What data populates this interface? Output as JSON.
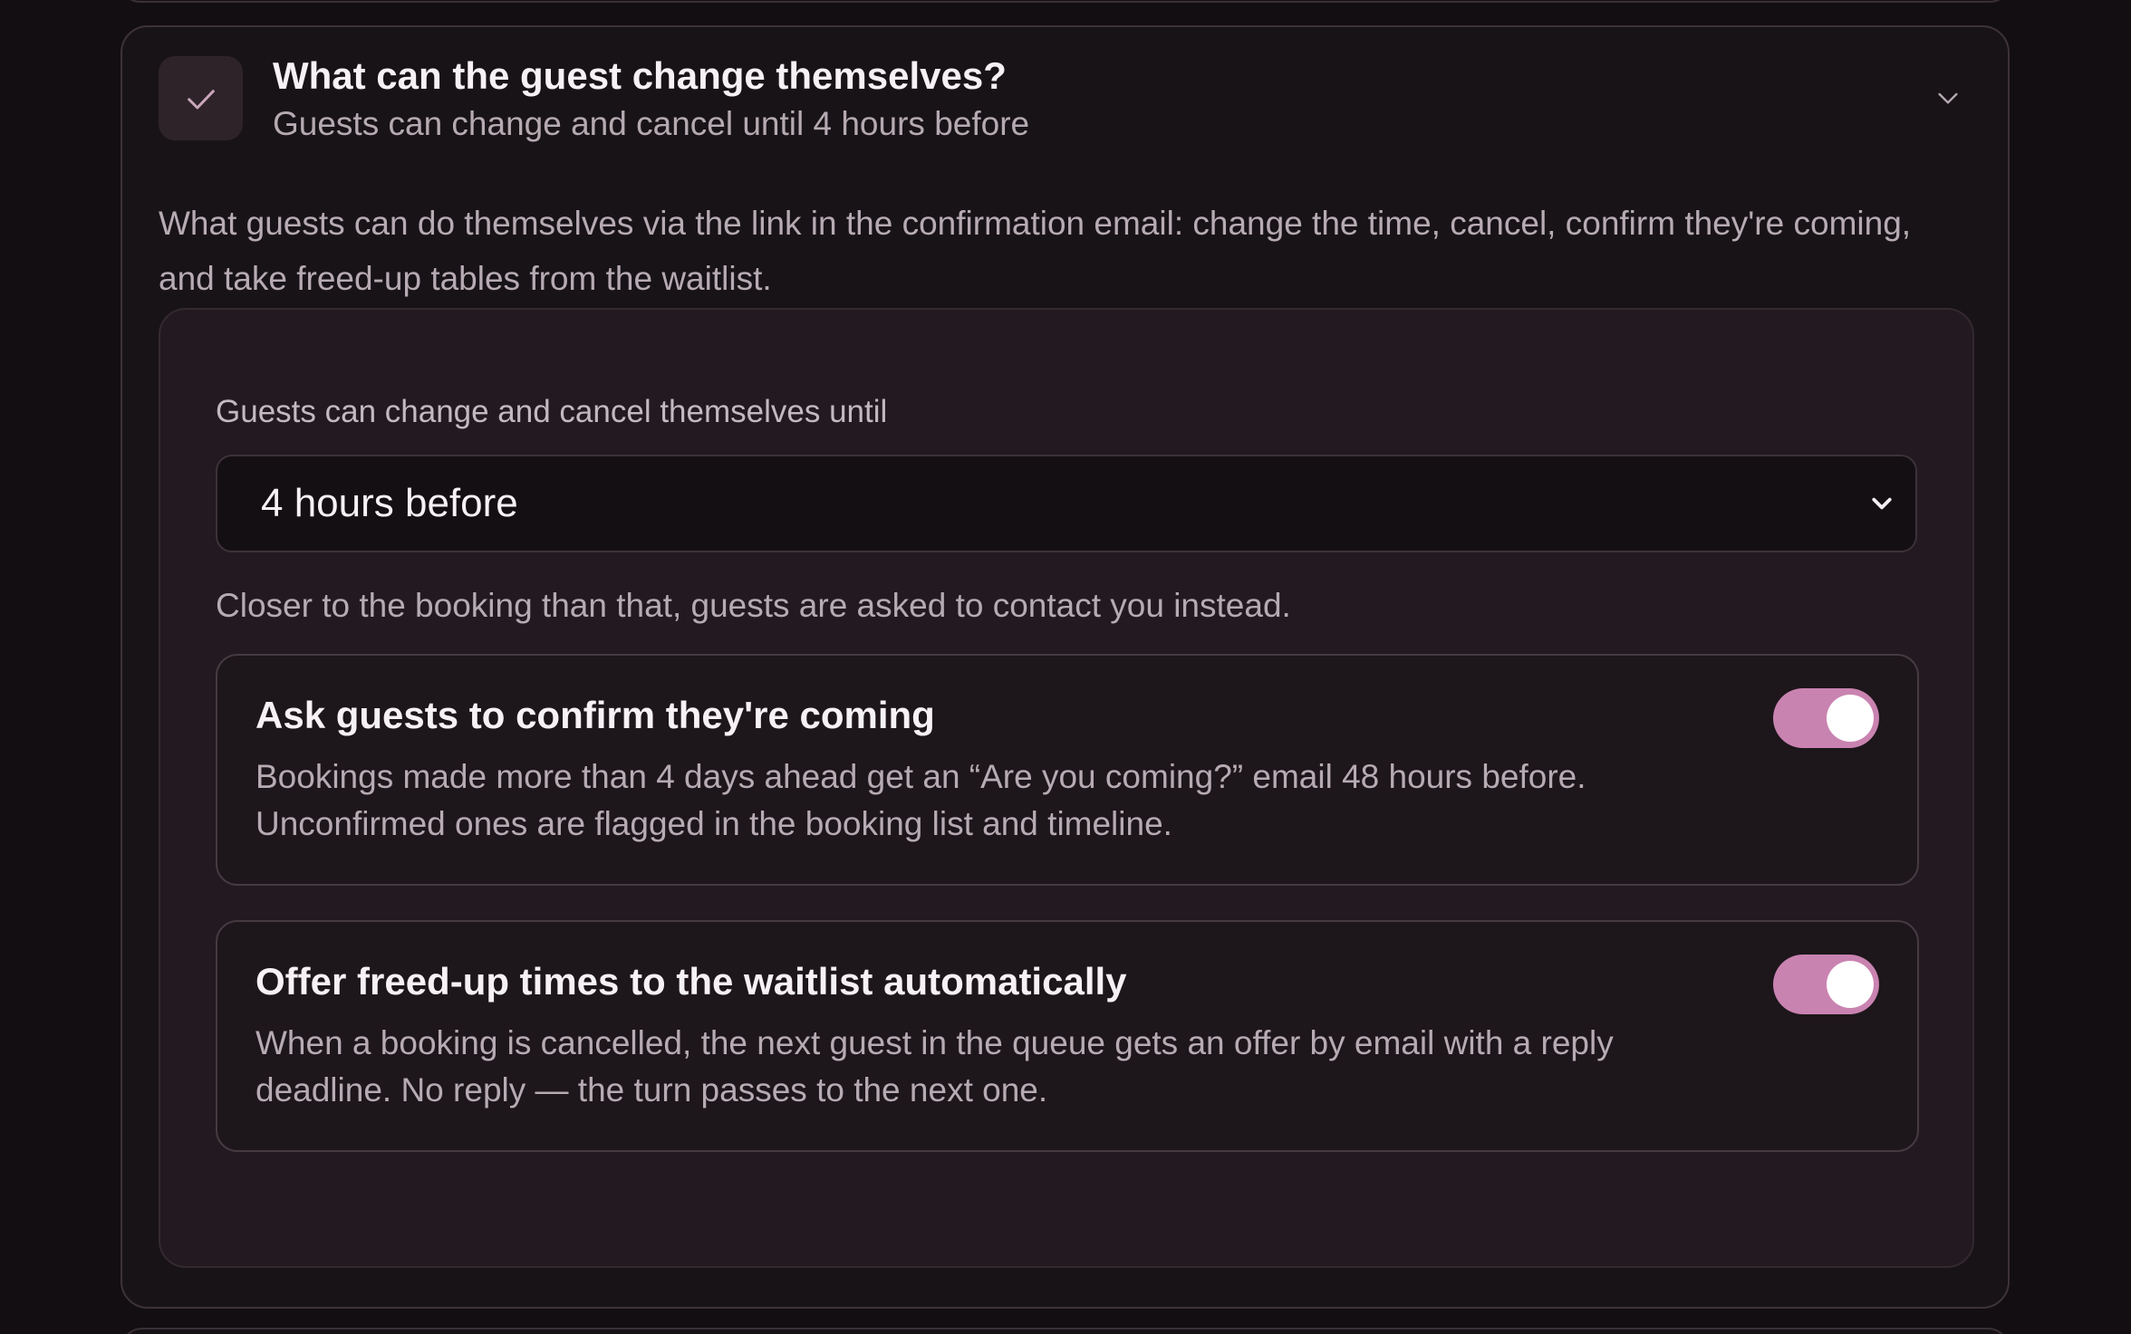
{
  "section": {
    "title": "What can the guest change themselves?",
    "subtitle": "Guests can change and cancel until 4 hours before",
    "description": "What guests can do themselves via the link in the confirmation email: change the time, cancel, confirm they're coming, and take freed-up tables from the waitlist.",
    "status_icon": "check-icon",
    "expand_icon": "chevron-down-icon"
  },
  "cutoff": {
    "label": "Guests can change and cancel themselves until",
    "selected": "4 hours before",
    "help": "Closer to the booking than that, guests are asked to contact you instead."
  },
  "options": [
    {
      "title": "Ask guests to confirm they're coming",
      "description": "Bookings made more than 4 days ahead get an “Are you coming?” email 48 hours before. Unconfirmed ones are flagged in the booking list and timeline.",
      "enabled": true
    },
    {
      "title": "Offer freed-up times to the waitlist automatically",
      "description": "When a booking is cancelled, the next guest in the queue gets an offer by email with a reply deadline. No reply — the turn passes to the next one.",
      "enabled": true
    }
  ],
  "colors": {
    "accent": "#c983b0",
    "background": "#120e11",
    "card": "#181317",
    "panel": "#221a20"
  }
}
